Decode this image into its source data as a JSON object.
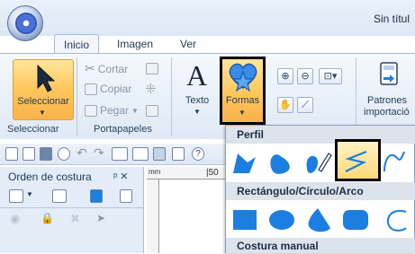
{
  "window": {
    "title": "Sin títul"
  },
  "tabs": [
    {
      "label": "Inicio",
      "active": true
    },
    {
      "label": "Imagen",
      "active": false
    },
    {
      "label": "Ver",
      "active": false
    }
  ],
  "ribbon": {
    "seleccionar_button": "Seleccionar",
    "groups": {
      "seleccionar": "Seleccionar",
      "portapapeles": "Portapapeles"
    },
    "clipboard": {
      "cut": "Cortar",
      "copy": "Copiar",
      "paste": "Pegar"
    },
    "texto_button": "Texto",
    "formas_button": "Formas",
    "patrones_button": {
      "line1": "Patrones",
      "line2": "importació"
    }
  },
  "left_panel": {
    "title": "Orden de costura",
    "pin": "ᵖ ✕"
  },
  "ruler": {
    "label": "|50"
  },
  "shapes_menu": {
    "sections": [
      {
        "label": "Perfil"
      },
      {
        "label": "Rectángulo/Círculo/Arco"
      },
      {
        "label": "Costura manual"
      }
    ]
  },
  "colors": {
    "accent_orange": "#ffc65c",
    "shape_blue": "#1a7fe0",
    "ribbon_blue": "#dfe9f5"
  }
}
